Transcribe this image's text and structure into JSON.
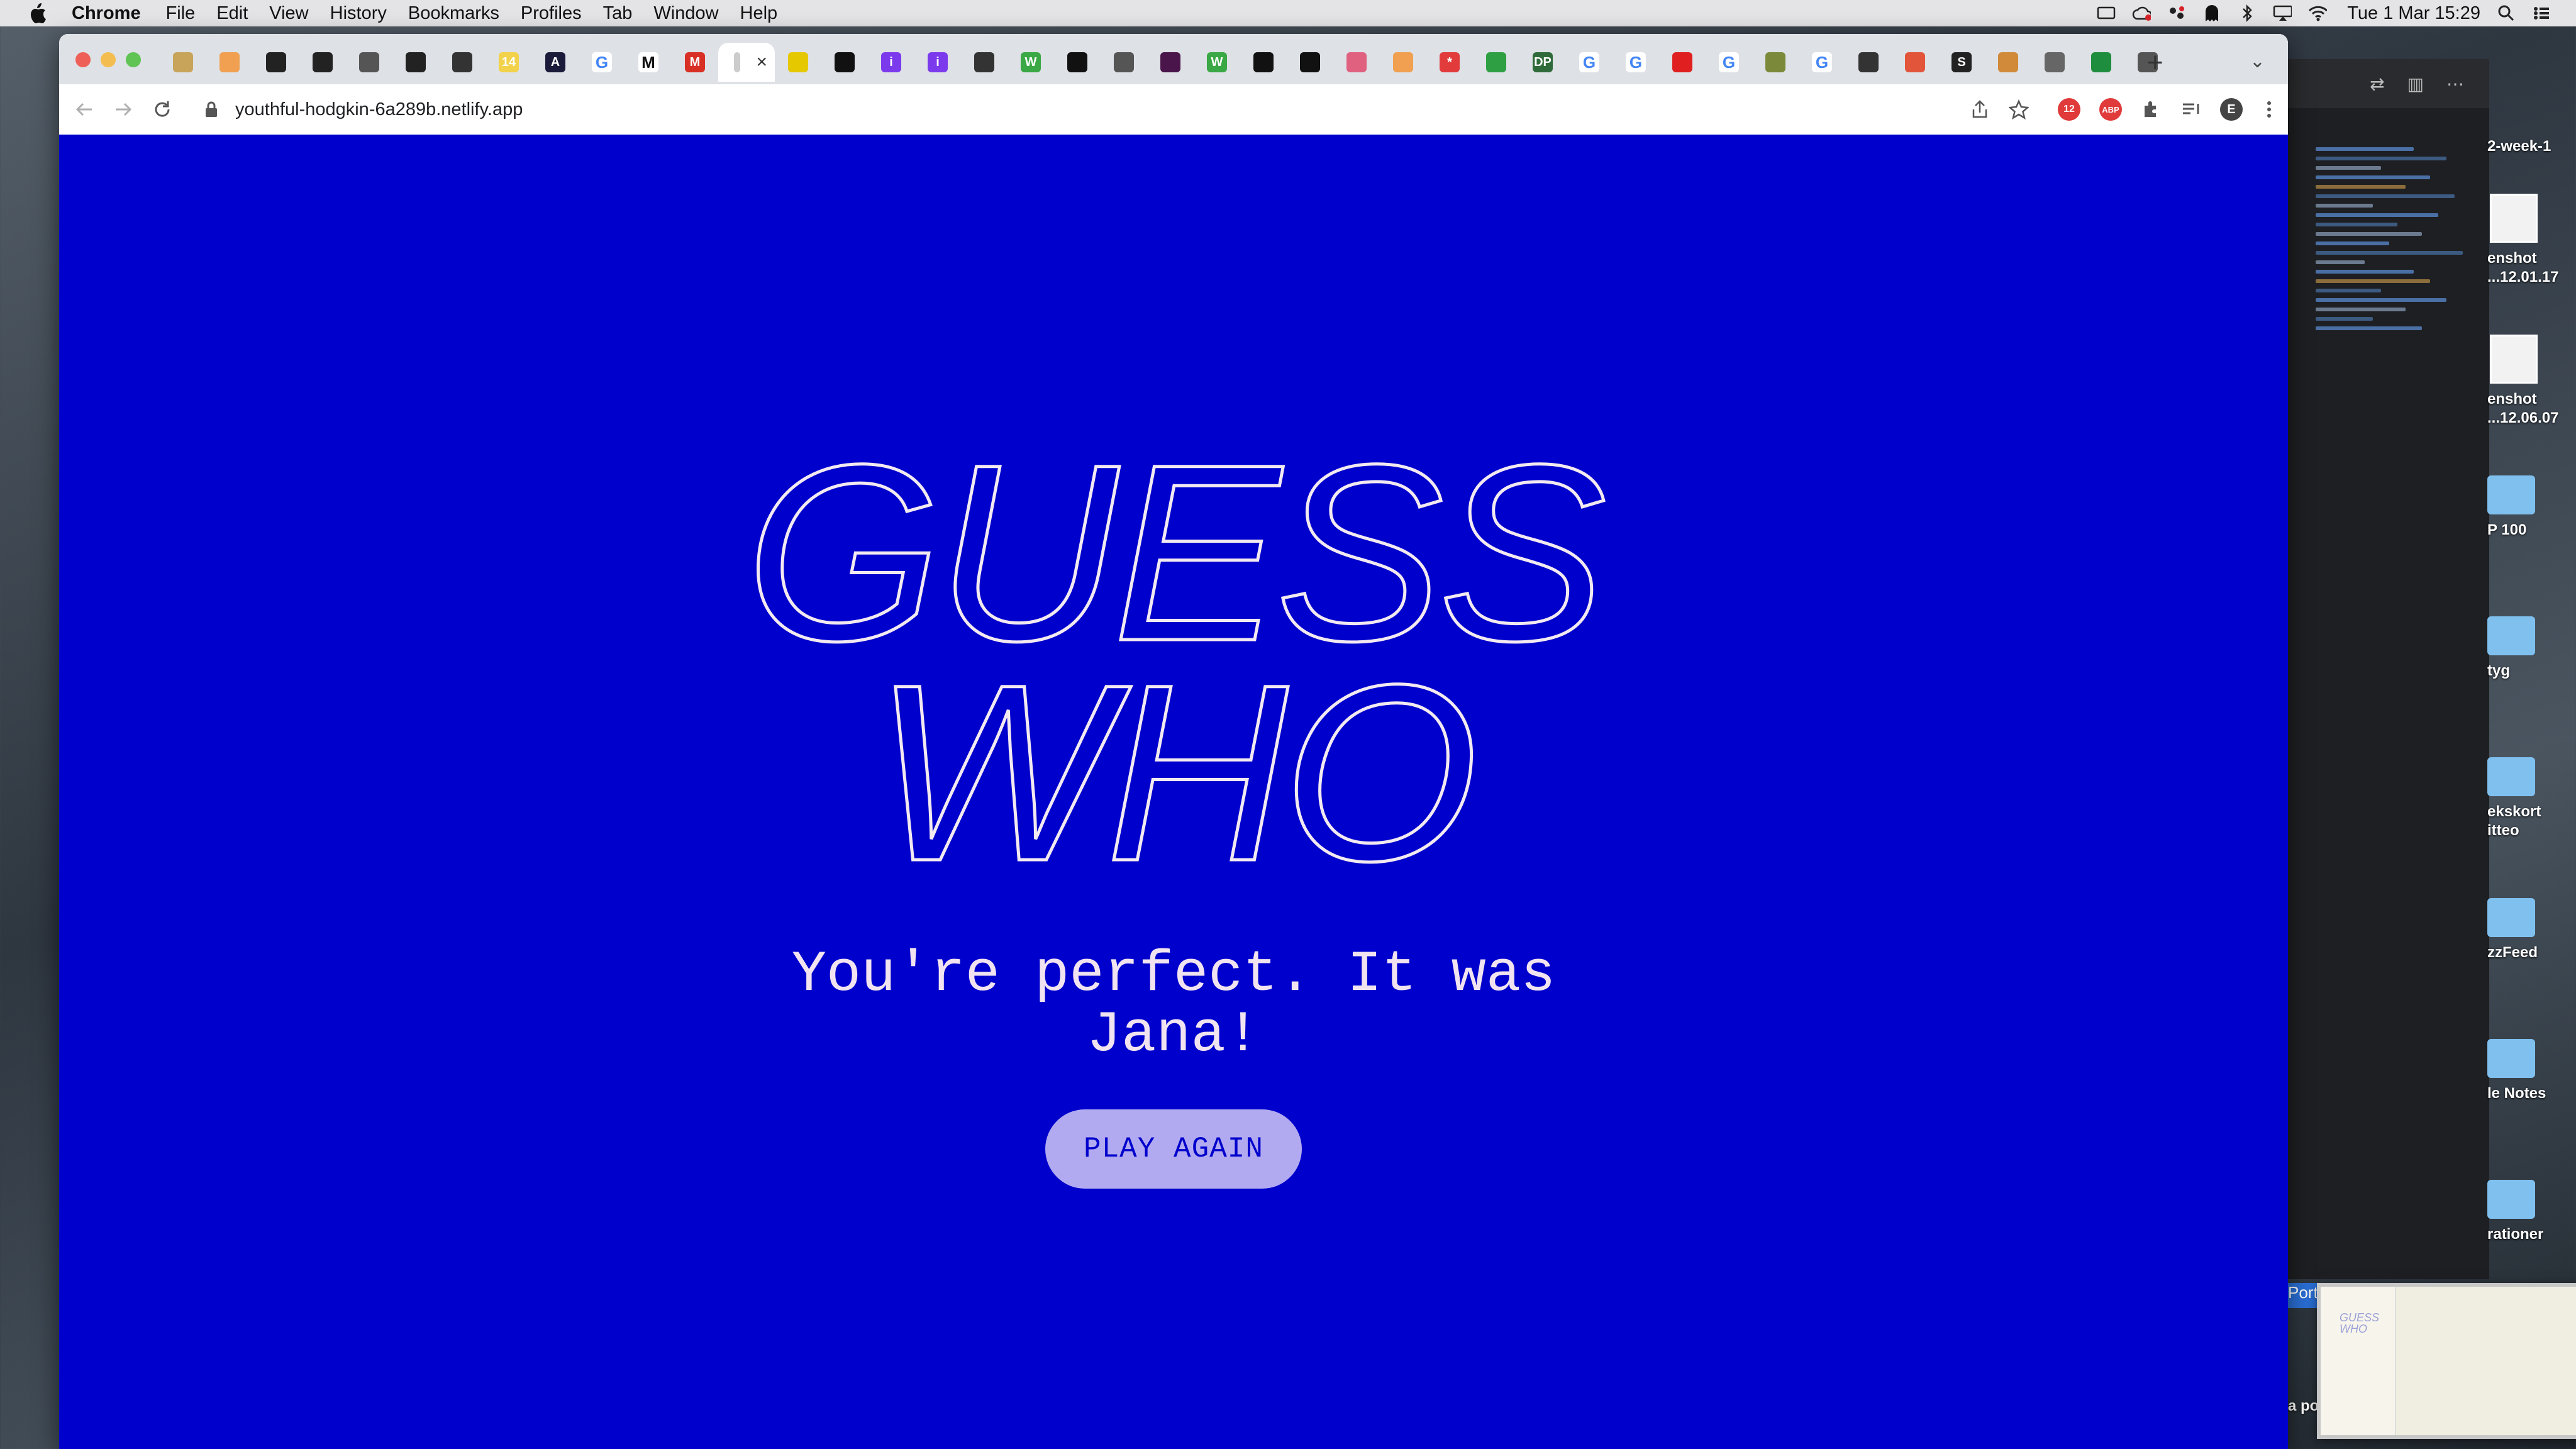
{
  "menubar": {
    "app_name": "Chrome",
    "menus": [
      "File",
      "Edit",
      "View",
      "History",
      "Bookmarks",
      "Profiles",
      "Tab",
      "Window",
      "Help"
    ],
    "clock": "Tue 1 Mar  15:29"
  },
  "browser": {
    "url": "youthful-hodgkin-6a289b.netlify.app",
    "profile_initial": "E",
    "abp_label": "ABP",
    "tabs": [
      {
        "icon": "amazon-icon",
        "glyph": "",
        "color": "#c8a45a"
      },
      {
        "icon": "stack-icon",
        "glyph": "",
        "color": "#f0a050"
      },
      {
        "icon": "github-icon",
        "glyph": "",
        "color": "#222222"
      },
      {
        "icon": "github-icon",
        "glyph": "",
        "color": "#222222"
      },
      {
        "icon": "globe-icon",
        "glyph": "",
        "color": "#555555"
      },
      {
        "icon": "github-icon",
        "glyph": "",
        "color": "#222222"
      },
      {
        "icon": "codesandbox-icon",
        "glyph": "",
        "color": "#333333"
      },
      {
        "icon": "sticky-note-icon",
        "glyph": "14",
        "color": "#f2d24b"
      },
      {
        "icon": "anchor-icon",
        "glyph": "A",
        "color": "#1a1a3a"
      },
      {
        "icon": "google-icon",
        "glyph": "G",
        "color": "#4285f4"
      },
      {
        "icon": "medium-icon",
        "glyph": "M",
        "color": "#111111"
      },
      {
        "icon": "gmail-icon",
        "glyph": "M",
        "color": "#d93025"
      },
      {
        "icon": "current-page-icon",
        "glyph": "",
        "color": "#cccccc"
      },
      {
        "icon": "sun-icon",
        "glyph": "",
        "color": "#e6c800"
      },
      {
        "icon": "bookmark-icon",
        "glyph": "",
        "color": "#111111"
      },
      {
        "icon": "info-icon",
        "glyph": "i",
        "color": "#7c3aed"
      },
      {
        "icon": "info-icon",
        "glyph": "i",
        "color": "#7c3aed"
      },
      {
        "icon": "codesandbox-icon",
        "glyph": "",
        "color": "#333333"
      },
      {
        "icon": "w-icon",
        "glyph": "W",
        "color": "#3aa845"
      },
      {
        "icon": "bookmark-icon",
        "glyph": "",
        "color": "#111111"
      },
      {
        "icon": "globe-icon",
        "glyph": "",
        "color": "#555555"
      },
      {
        "icon": "slack-icon",
        "glyph": "",
        "color": "#4a154b"
      },
      {
        "icon": "w-icon",
        "glyph": "W",
        "color": "#3aa845"
      },
      {
        "icon": "bookmark-icon",
        "glyph": "",
        "color": "#111111"
      },
      {
        "icon": "bookmark-icon",
        "glyph": "",
        "color": "#111111"
      },
      {
        "icon": "colorwheel-icon",
        "glyph": "",
        "color": "#e06080"
      },
      {
        "icon": "stack-icon",
        "glyph": "",
        "color": "#f0a050"
      },
      {
        "icon": "asterisk-icon",
        "glyph": "*",
        "color": "#e23b3b"
      },
      {
        "icon": "play-icon",
        "glyph": "",
        "color": "#2ea043"
      },
      {
        "icon": "dp-icon",
        "glyph": "DP",
        "color": "#2f6b3a"
      },
      {
        "icon": "google-icon",
        "glyph": "G",
        "color": "#4285f4"
      },
      {
        "icon": "google-icon",
        "glyph": "G",
        "color": "#4285f4"
      },
      {
        "icon": "youtube-icon",
        "glyph": "",
        "color": "#e02020"
      },
      {
        "icon": "google-icon",
        "glyph": "G",
        "color": "#4285f4"
      },
      {
        "icon": "css-icon",
        "glyph": "",
        "color": "#7a8a3a"
      },
      {
        "icon": "google-icon",
        "glyph": "G",
        "color": "#4285f4"
      },
      {
        "icon": "square-icon",
        "glyph": "",
        "color": "#333333"
      },
      {
        "icon": "settings-icon",
        "glyph": "",
        "color": "#e2553b"
      },
      {
        "icon": "terminal-icon",
        "glyph": "S",
        "color": "#222222"
      },
      {
        "icon": "fox-icon",
        "glyph": "",
        "color": "#d08a3a"
      },
      {
        "icon": "speaker-icon",
        "glyph": "",
        "color": "#666666"
      },
      {
        "icon": "sheets-icon",
        "glyph": "",
        "color": "#1e8e3e"
      },
      {
        "icon": "globe-icon",
        "glyph": "",
        "color": "#555555"
      }
    ]
  },
  "page": {
    "title_lines": [
      "GUESS",
      "WHO"
    ],
    "result_lines": [
      "You're perfect. It was",
      "Jana!"
    ],
    "play_again_label": "PLAY AGAIN",
    "background_color": "#0000cc",
    "button_color": "#b2aaf0"
  },
  "desktop": {
    "items": [
      {
        "label": "2-week-1",
        "kind": "folder"
      },
      {
        "label": "enshot\n...12.01.17",
        "kind": "screenshot"
      },
      {
        "label": "enshot\n...12.06.07",
        "kind": "screenshot"
      },
      {
        "label": "P 100",
        "kind": "folder"
      },
      {
        "label": "tyg",
        "kind": "folder"
      },
      {
        "label": "ekskort\nitteo",
        "kind": "folder"
      },
      {
        "label": "zzFeed",
        "kind": "folder"
      },
      {
        "label": "le Notes",
        "kind": "folder"
      },
      {
        "label": "rationer",
        "kind": "folder"
      }
    ],
    "thumb_title_lines": [
      "GUESS",
      "WHO"
    ],
    "side_text": "Port",
    "side_text_2": "a po"
  }
}
